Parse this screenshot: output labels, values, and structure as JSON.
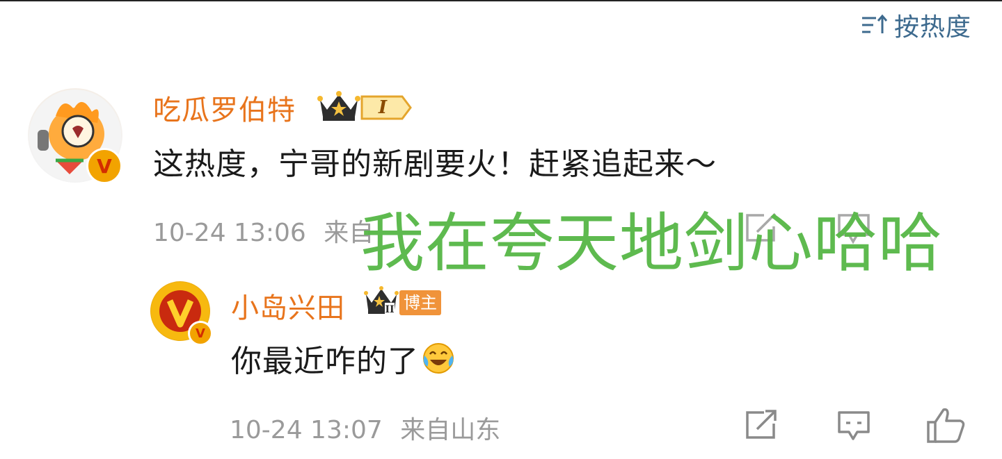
{
  "sort": {
    "label": "按热度",
    "icon": "sort-icon"
  },
  "comments": [
    {
      "username": "吃瓜罗伯特",
      "badge_level": "I",
      "badge_icon": "crown-icon",
      "text": "这热度，宁哥的新剧要火！赶紧追起来～",
      "time": "10-24 13:06",
      "location": "来自"
    },
    {
      "username": "小岛兴田",
      "badge_level": "II",
      "badge_label": "博主",
      "badge_icon": "crown-icon",
      "text": "你最近咋的了",
      "emoji": "laugh-cry-emoji",
      "time": "10-24 13:07",
      "location": "来自山东",
      "actions": [
        "share-icon",
        "comment-icon",
        "like-icon"
      ]
    }
  ],
  "overlay_text": "我在夸天地剑心哈哈",
  "colors": {
    "username": "#e8741c",
    "sort": "#3d6a8e",
    "meta": "#9a9a9a",
    "overlay": "#58b848",
    "verified": "#f2a300"
  }
}
